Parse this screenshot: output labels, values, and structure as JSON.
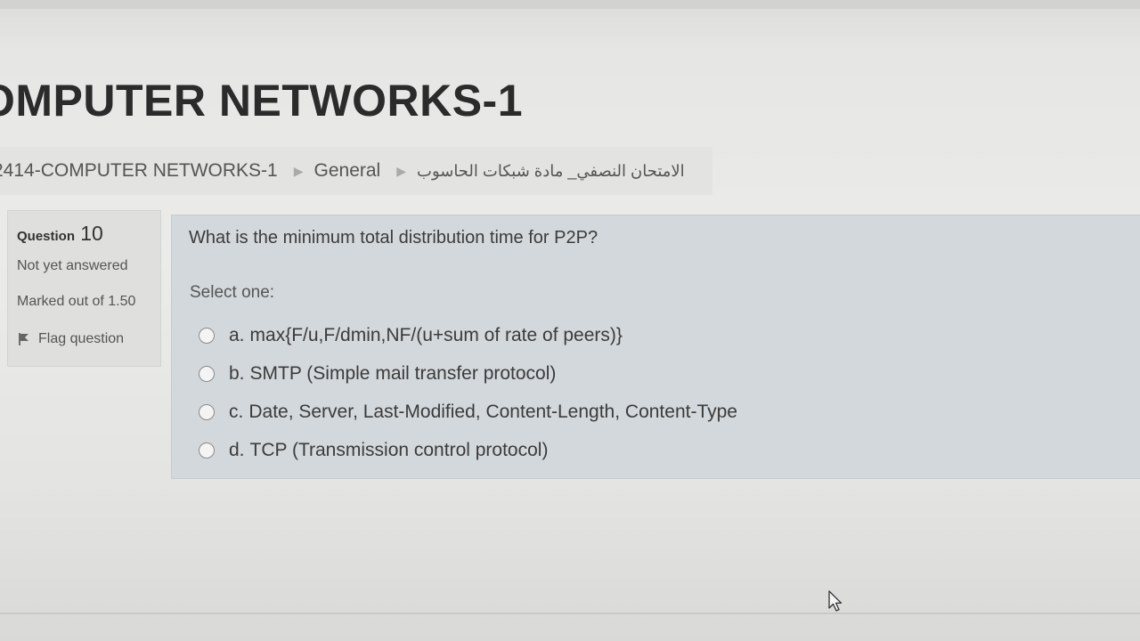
{
  "page": {
    "title": "OMPUTER NETWORKS-1"
  },
  "breadcrumb": {
    "items": [
      {
        "label": "2414-COMPUTER NETWORKS-1"
      },
      {
        "label": "General"
      },
      {
        "label": "الامتحان النصفي_ مادة شبكات الحاسوب"
      }
    ],
    "separator_icon": "triangle-right-icon"
  },
  "question_info": {
    "number_label": "Question",
    "number": "10",
    "state": "Not yet answered",
    "grade": "Marked out of 1.50",
    "flag_label": "Flag question",
    "flag_icon": "flag-icon"
  },
  "question": {
    "text": "What is the minimum total distribution time for P2P?",
    "prompt": "Select one:",
    "options": [
      {
        "letter": "a.",
        "text": "max{F/u,F/dmin,NF/(u+sum of rate of peers)}"
      },
      {
        "letter": "b.",
        "text": "SMTP (Simple mail transfer protocol)"
      },
      {
        "letter": "c.",
        "text": "Date, Server, Last-Modified, Content-Length, Content-Type"
      },
      {
        "letter": "d.",
        "text": "TCP (Transmission control protocol)"
      }
    ]
  },
  "colors": {
    "content_bg": "#d3d8dc",
    "info_bg": "#dfdfdd",
    "page_bg": "#ebebea",
    "title_text": "#2b2b2b"
  }
}
